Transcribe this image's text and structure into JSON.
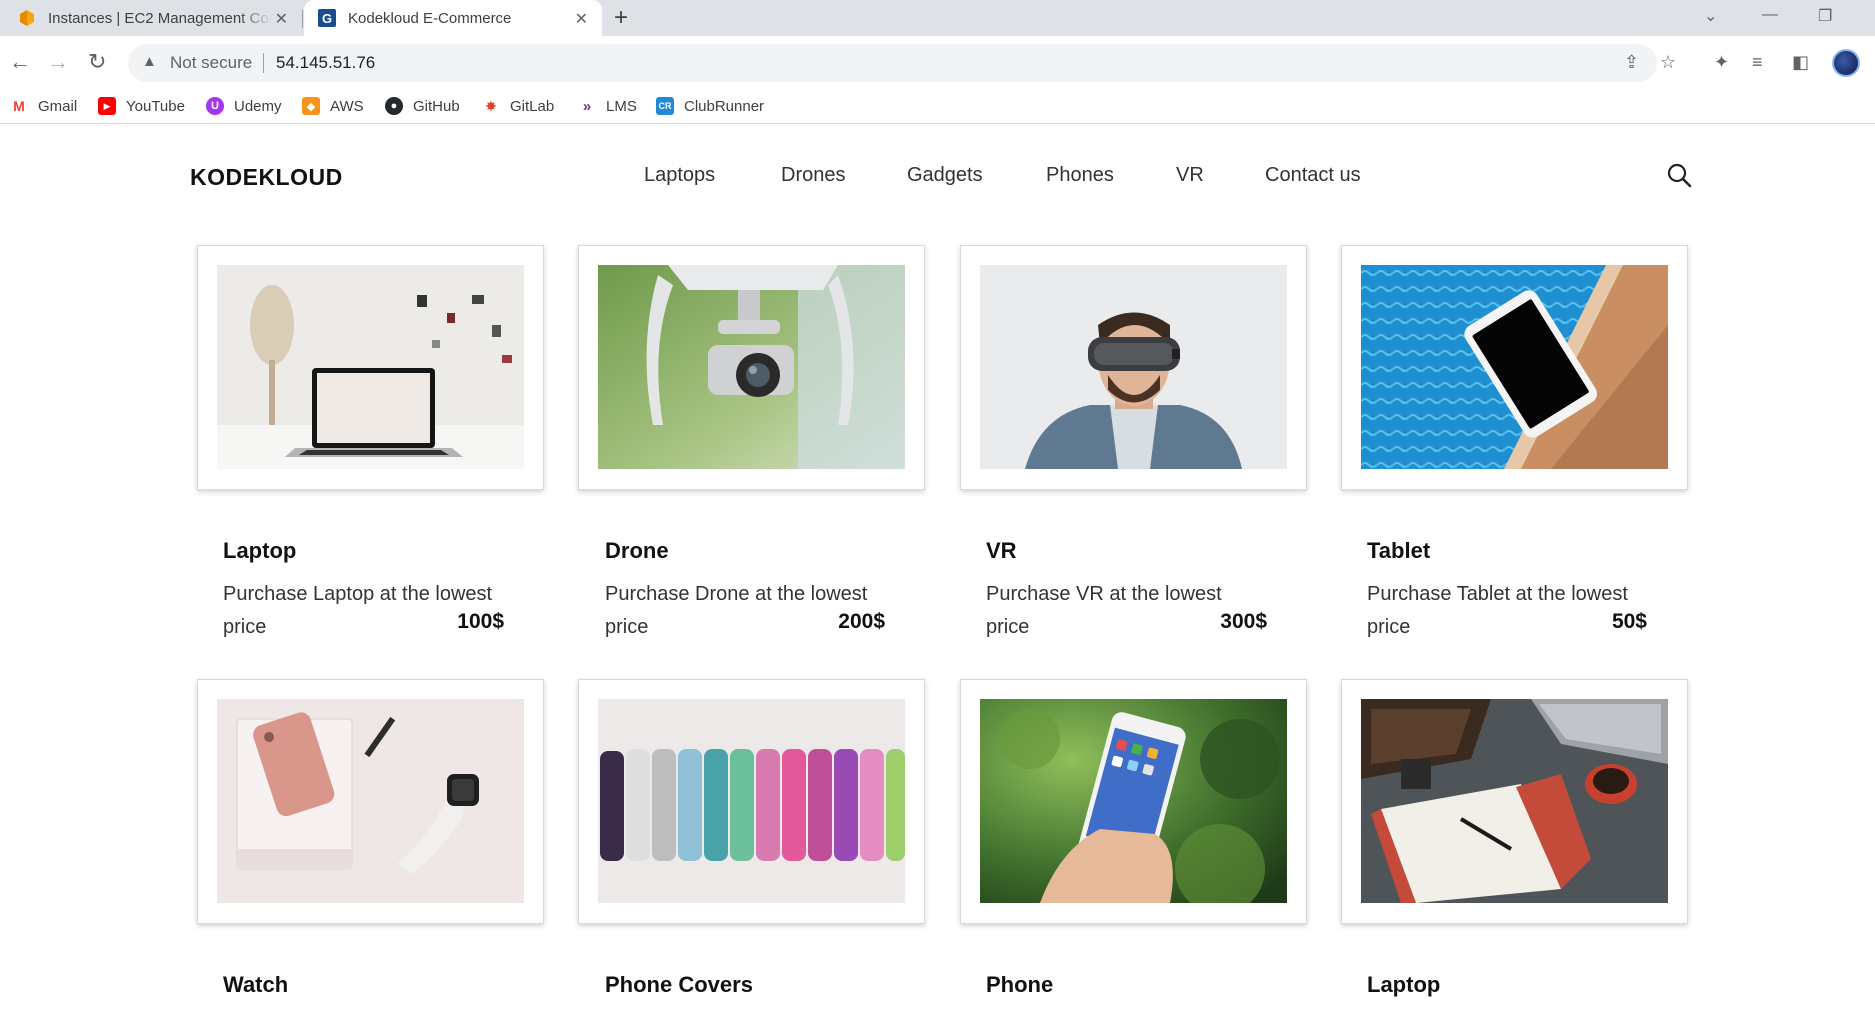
{
  "browser": {
    "tabs": [
      {
        "title": "Instances | EC2 Management Console",
        "icon": "aws-icon"
      },
      {
        "title": "Kodekloud E-Commerce",
        "icon": "site-favicon"
      }
    ],
    "address": {
      "security_label": "Not secure",
      "url": "54.145.51.76"
    },
    "bookmarks": [
      {
        "label": "Gmail",
        "icon": "gmail-icon",
        "color": "#ea4335"
      },
      {
        "label": "YouTube",
        "icon": "youtube-icon",
        "color": "#ff0000"
      },
      {
        "label": "Udemy",
        "icon": "udemy-icon",
        "color": "#a435f0"
      },
      {
        "label": "AWS",
        "icon": "aws-icon",
        "color": "#f7931e"
      },
      {
        "label": "GitHub",
        "icon": "github-icon",
        "color": "#24292e"
      },
      {
        "label": "GitLab",
        "icon": "gitlab-icon",
        "color": "#e24329"
      },
      {
        "label": "LMS",
        "icon": "lms-icon",
        "color": "#7b2d8e"
      },
      {
        "label": "ClubRunner",
        "icon": "clubrunner-icon",
        "color": "#1f8ad6"
      }
    ]
  },
  "site": {
    "logo": "KODEKLOUD",
    "nav": [
      "Laptops",
      "Drones",
      "Gadgets",
      "Phones",
      "VR",
      "Contact us"
    ]
  },
  "products": [
    {
      "name": "Laptop",
      "description": "Purchase Laptop at the lowest price",
      "price": "100$",
      "image": "laptop-photo"
    },
    {
      "name": "Drone",
      "description": "Purchase Drone at the lowest price",
      "price": "200$",
      "image": "drone-photo"
    },
    {
      "name": "VR",
      "description": "Purchase VR at the lowest price",
      "price": "300$",
      "image": "vr-photo"
    },
    {
      "name": "Tablet",
      "description": "Purchase Tablet at the lowest price",
      "price": "50$",
      "image": "tablet-photo"
    },
    {
      "name": "Watch",
      "image": "watch-photo"
    },
    {
      "name": "Phone Covers",
      "image": "phone-covers-photo"
    },
    {
      "name": "Phone",
      "image": "phone-photo"
    },
    {
      "name": "Laptop",
      "image": "laptop-desk-photo"
    }
  ]
}
